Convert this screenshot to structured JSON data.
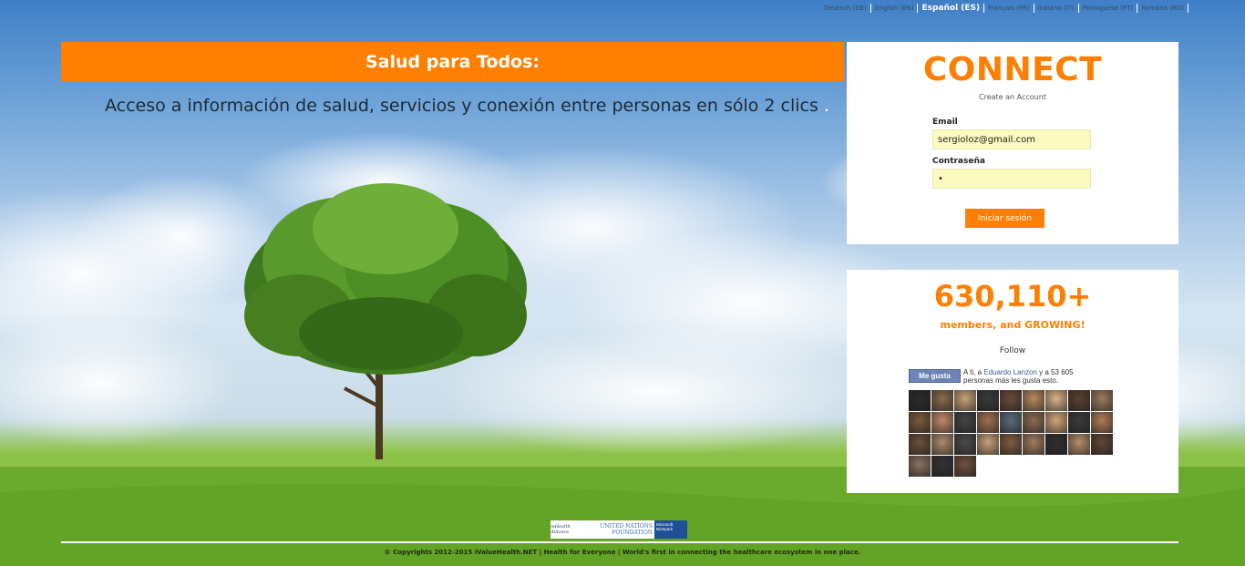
{
  "languages": [
    {
      "label": "Deutsch (DE)",
      "active": false
    },
    {
      "label": "English (EN)",
      "active": false
    },
    {
      "label": "Español (ES)",
      "active": true
    },
    {
      "label": "Français (FR)",
      "active": false
    },
    {
      "label": "Italiano (IT)",
      "active": false
    },
    {
      "label": "Portuguese (PT)",
      "active": false
    },
    {
      "label": "Româna (RO)",
      "active": false
    }
  ],
  "hero": {
    "title": "Salud para Todos:",
    "subtitle": "Acceso a información de salud, servicios y conexión entre personas en sólo 2 clics",
    "subtitle_dot": "."
  },
  "connect": {
    "title": "CONNECT",
    "create_account": "Create an Account",
    "email_label": "Email",
    "email_value": "sergioloz@gmail.com",
    "password_label": "Contraseña",
    "password_value": "•",
    "login_button": "Iniciar sesión"
  },
  "members": {
    "count": "630,110+",
    "subtitle": "members, and GROWING!",
    "follow": "Follow",
    "like_button": "Me gusta",
    "like_text_prefix": "A ti, a ",
    "like_text_name": "Eduardo Lanzon",
    "like_text_suffix": " y a 53 605 personas más les gusta esto."
  },
  "footer": {
    "logo_mhealth": "mHealth Alliance",
    "logo_un": "UNITED NATIONS FOUNDATION",
    "logo_ms": "Microsoft BizSpark",
    "copyright": "© Copyrights 2012-2015 iValueHealth.NET | Health for Everyone | World's first in connecting the healthcare ecosystem in one place."
  },
  "colors": {
    "accent": "#ff7f00",
    "input_bg": "#fbfbc0",
    "facebook": "#6d84b4"
  }
}
